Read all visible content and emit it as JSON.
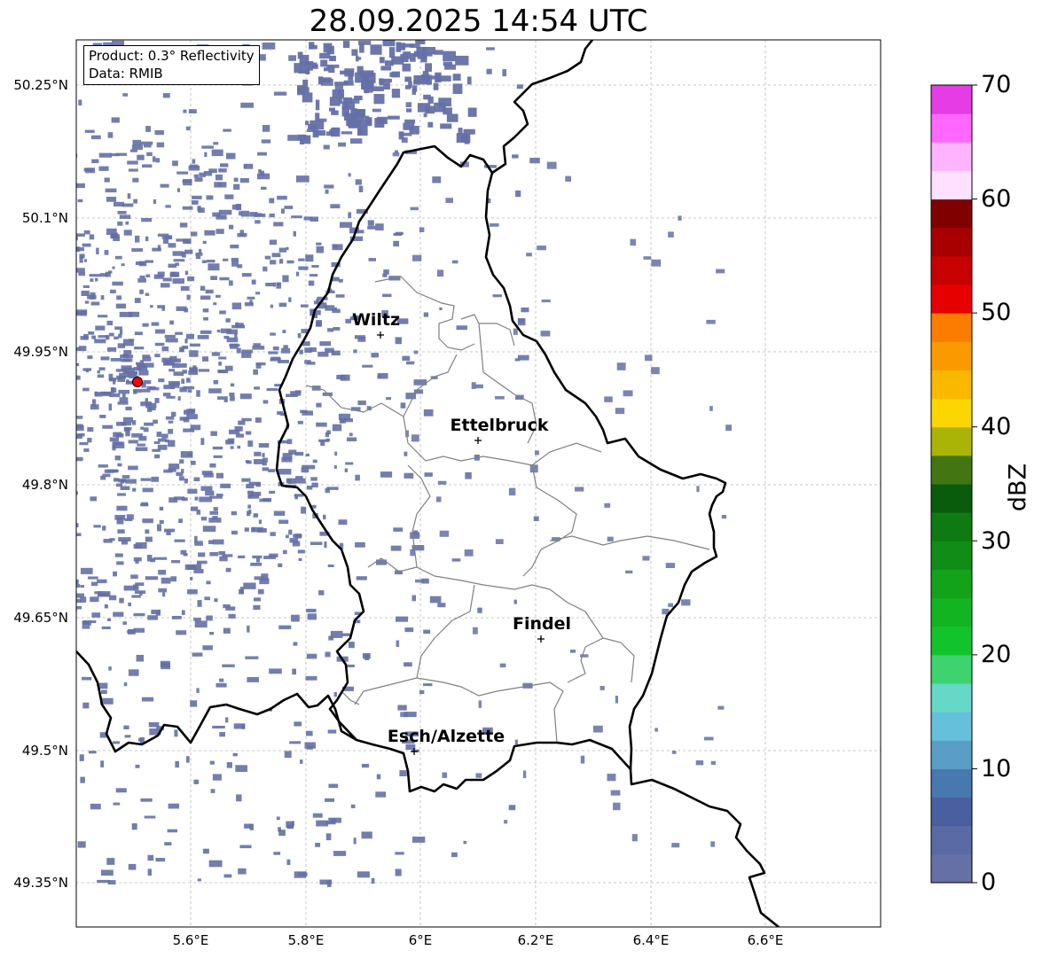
{
  "title": "28.09.2025 14:54 UTC",
  "info_box": {
    "product_line": "Product: 0.3° Reflectivity",
    "data_line": "Data: RMIB"
  },
  "colorbar": {
    "unit": "dBZ",
    "tick_labels": [
      "0",
      "10",
      "20",
      "30",
      "40",
      "50",
      "60",
      "70"
    ],
    "colors": [
      "#6470a6",
      "#5a6aa5",
      "#4a5fa0",
      "#4778b0",
      "#5a9ec6",
      "#65c0dc",
      "#65d8c8",
      "#3ed36e",
      "#12c42c",
      "#12b422",
      "#12a31a",
      "#108d16",
      "#0e7a12",
      "#0a5c0d",
      "#437613",
      "#aab406",
      "#fbd600",
      "#fbb800",
      "#fb9a00",
      "#fb7c00",
      "#e60000",
      "#c70000",
      "#a80000",
      "#800000",
      "#ffe0ff",
      "#ffb4ff",
      "#ff68ff",
      "#e63ce6"
    ]
  },
  "axes": {
    "lat_labels": [
      "50.25°N",
      "50.1°N",
      "49.95°N",
      "49.8°N",
      "49.65°N",
      "49.5°N",
      "49.35°N"
    ],
    "lon_labels": [
      "5.6°E",
      "5.8°E",
      "6°E",
      "6.2°E",
      "6.4°E",
      "6.6°E"
    ]
  },
  "cities": [
    {
      "name": "Wiltz"
    },
    {
      "name": "Ettelbruck"
    },
    {
      "name": "Findel"
    },
    {
      "name": "Esch/Alzette"
    }
  ],
  "radar_site": {
    "color": "#ff0000"
  },
  "echo_color": "#6470a6"
}
